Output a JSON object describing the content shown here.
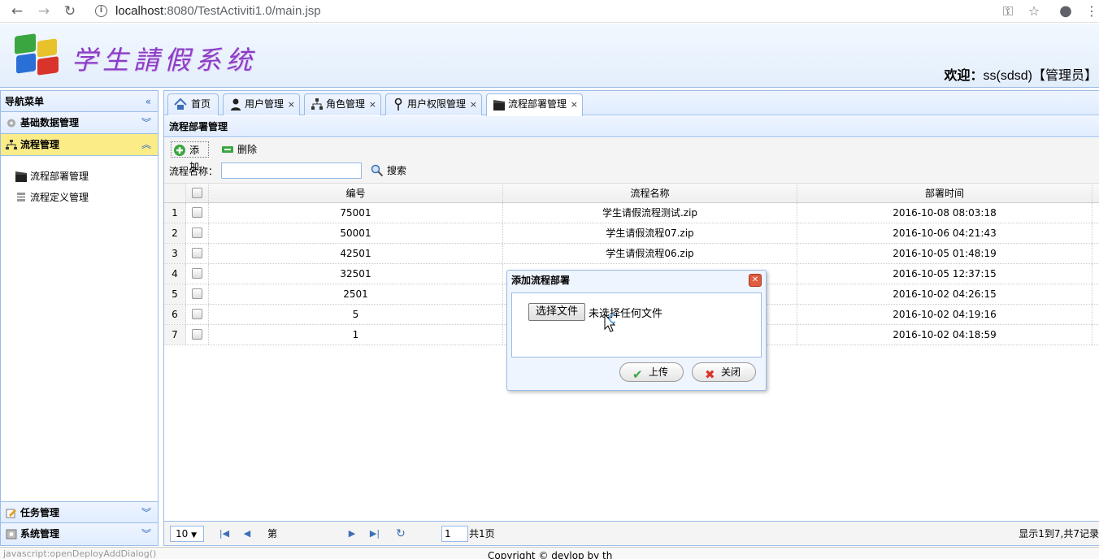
{
  "browser": {
    "url_host": "localhost",
    "url_path": ":8080/TestActiviti1.0/main.jsp"
  },
  "header": {
    "app_title": "学生請假系统",
    "welcome_label": "欢迎：",
    "welcome_user": "ss(sdsd)【管理员】"
  },
  "nav": {
    "title": "导航菜单",
    "sections": [
      {
        "label": "基础数据管理"
      },
      {
        "label": "流程管理"
      },
      {
        "label": "任务管理"
      },
      {
        "label": "系统管理"
      }
    ],
    "items": [
      {
        "label": "流程部署管理"
      },
      {
        "label": "流程定义管理"
      }
    ]
  },
  "tabs": [
    {
      "label": "首页"
    },
    {
      "label": "用户管理"
    },
    {
      "label": "角色管理"
    },
    {
      "label": "用户权限管理"
    },
    {
      "label": "流程部署管理"
    }
  ],
  "tab_close": "×",
  "panel": {
    "title": "流程部署管理",
    "add_label": "添加",
    "delete_label": "删除",
    "search_label": "流程名称：",
    "search_button": "搜索"
  },
  "grid": {
    "columns": [
      "编号",
      "流程名称",
      "部署时间"
    ],
    "rows": [
      {
        "num": "1",
        "id": "75001",
        "name": "学生请假流程测试.zip",
        "time": "2016-10-08 08:03:18"
      },
      {
        "num": "2",
        "id": "50001",
        "name": "学生请假流程07.zip",
        "time": "2016-10-06 04:21:43"
      },
      {
        "num": "3",
        "id": "42501",
        "name": "学生请假流程06.zip",
        "time": "2016-10-05 01:48:19"
      },
      {
        "num": "4",
        "id": "32501",
        "name": "",
        "time": "2016-10-05 12:37:15"
      },
      {
        "num": "5",
        "id": "2501",
        "name": "",
        "time": "2016-10-02 04:26:15"
      },
      {
        "num": "6",
        "id": "5",
        "name": "",
        "time": "2016-10-02 04:19:16"
      },
      {
        "num": "7",
        "id": "1",
        "name": "",
        "time": "2016-10-02 04:18:59"
      }
    ]
  },
  "pager": {
    "page_size": "10",
    "page_prefix": "第",
    "page_value": "1",
    "page_total": "共1页",
    "info": "显示1到7,共7记录"
  },
  "dialog": {
    "title": "添加流程部署",
    "file_button": "选择文件",
    "file_status": "未选择任何文件",
    "upload_label": "上传",
    "close_label": "关闭"
  },
  "footer": {
    "status": "javascript:openDeployAddDialog()",
    "copyright": "Copyright © devlop by th"
  }
}
